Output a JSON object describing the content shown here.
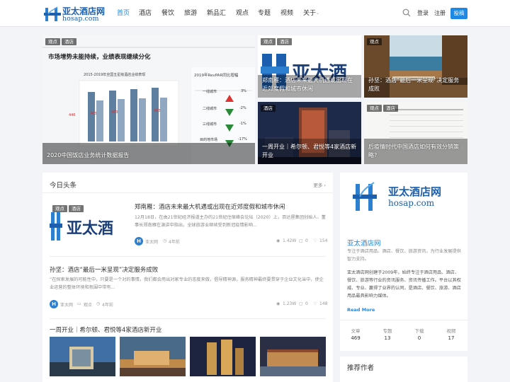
{
  "header": {
    "logo_cn": "亚太酒店网",
    "logo_en": "hosap.com",
    "nav": [
      "首页",
      "酒店",
      "餐饮",
      "旅游",
      "新品汇",
      "观点",
      "专题",
      "视频",
      "关于"
    ],
    "login": "登录",
    "register": "注册",
    "submit": "投稿",
    "accent": "#1e88e5"
  },
  "hero": {
    "big": {
      "tags": [
        "观点",
        "酒店"
      ],
      "title": "2020中国饭店业务统计数据报告",
      "img_heading": "市场增势未能持续，业绩表现继续分化",
      "chart_title": "2015-2019年全国五星级酒店业绩表现",
      "chart_values": [
        "446",
        "463",
        "483",
        "483"
      ],
      "chart_years": [
        "2015",
        "2016",
        "2017",
        "2018",
        "2019"
      ],
      "revpar_title": "2019年RevPAR同比增幅",
      "revpar_rows": [
        {
          "city": "一线城市",
          "val": "3%"
        },
        {
          "city": "二线城市",
          "val": "-2%"
        },
        {
          "city": "三线城市",
          "val": "-1%"
        },
        {
          "city": "目的地市场",
          "val": "-17%"
        }
      ]
    },
    "cards": [
      {
        "tags": [
          "观点",
          "酒店"
        ],
        "title": "郑南雁：酒店未来最大机遇或出现在近郊度假和城市休闲"
      },
      {
        "tags": [
          "观点"
        ],
        "title": "孙坚：酒店“最后一米呈现”决定服务成败"
      },
      {
        "tags": [
          "酒店"
        ],
        "title": "一周开业｜希尔顿、君悦等4家酒店新开业"
      },
      {
        "tags": [
          "观点",
          "酒店"
        ],
        "title": "后疫情时代中国酒店如何有效分销策略?"
      }
    ]
  },
  "today": {
    "title": "今日头条",
    "more": "更多 ›",
    "articles": [
      {
        "tags": [
          "观点",
          "酒店"
        ],
        "title": "郑南雁：酒店未来最大机遇或出现在近郊度假和城市休闲",
        "desc": "12月18日，在由21世纪经济报道主办的21世纪住宿峰会论坛（2020）上，百达屋集团创始人、董事长郑南雁在演讲中指出，全球旅游业继续受到新冠疫情影响...",
        "author": "亚太网",
        "time": "4年前",
        "views": "1.42W",
        "comments": "0",
        "likes": "154"
      },
      {
        "title": "孙坚：酒店“最后一米呈现”决定服务成败",
        "desc": "“在探索发展的可能性中，只要是一个对的事情，我们都会用出对家专业的态度来做，倡导精神源，服务精神最终要贯穿于企业文化当中，使企业运营的整体环境和氛围中带有...",
        "author": "亚太网",
        "category": "观点",
        "time": "4年前",
        "views": "1.23W",
        "comments": "0",
        "likes": "148"
      },
      {
        "title": "一周开业｜希尔顿、君悦等4家酒店新开业"
      }
    ]
  },
  "sidebar": {
    "logo_cn": "亚太酒店网",
    "logo_en": "hosap.com",
    "name": "亚太酒店网",
    "tagline": "专注于酒店用品、酒店、餐饮、旅游资讯，为行业发展提供智力支持。",
    "about": "亚太酒店网创建于2009年，始终专注于酒店用品、酒店、餐饮、旅游等行业的资讯服务、资讯传播工作。平台以其权威、专业、赢得了业界的认同，是酒店、餐饮、旅游、酒店用品最具影响力媒体。",
    "read_more": "Read More",
    "stats": [
      {
        "label": "文章",
        "value": "469"
      },
      {
        "label": "专题",
        "value": "13"
      },
      {
        "label": "下载",
        "value": "0"
      },
      {
        "label": "视频",
        "value": "17"
      }
    ],
    "authors_title": "推荐作者"
  }
}
